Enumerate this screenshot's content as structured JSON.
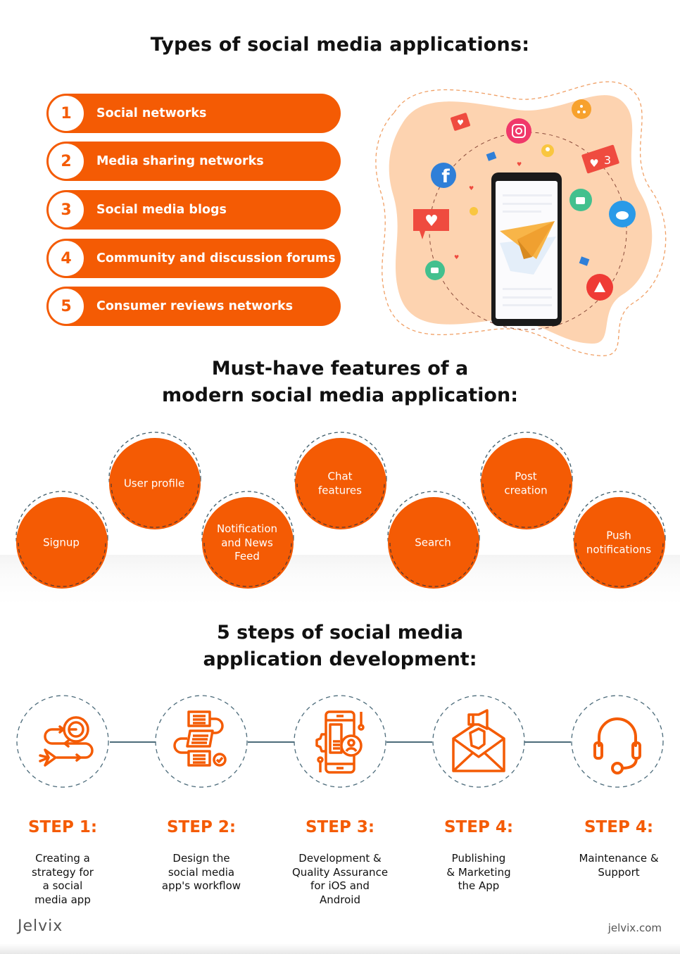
{
  "section_types": {
    "title": "Types of social media applications:",
    "items": [
      {
        "number": "1",
        "label": "Social networks"
      },
      {
        "number": "2",
        "label": "Media sharing networks"
      },
      {
        "number": "3",
        "label": "Social media blogs"
      },
      {
        "number": "4",
        "label": "Community and discussion forums"
      },
      {
        "number": "5",
        "label": "Consumer reviews networks"
      }
    ],
    "illustration": {
      "badge_count": "3",
      "icons": [
        "heart-comment-icon",
        "instagram-icon",
        "share-icon",
        "facebook-icon",
        "user-icon",
        "heart-count-icon",
        "thumbs-up-icon",
        "twitter-icon",
        "youtube-play-icon",
        "paper-plane-icon",
        "smartphone-icon"
      ]
    }
  },
  "section_features": {
    "title_line1": "Must-have features of a",
    "title_line2": "modern social media application:",
    "items": [
      {
        "line1": "Signup",
        "line2": "",
        "line3": ""
      },
      {
        "line1": "User profile",
        "line2": "",
        "line3": ""
      },
      {
        "line1": "Notification",
        "line2": "and News",
        "line3": "Feed"
      },
      {
        "line1": "Chat",
        "line2": "features",
        "line3": ""
      },
      {
        "line1": "Search",
        "line2": "",
        "line3": ""
      },
      {
        "line1": "Post",
        "line2": "creation",
        "line3": ""
      },
      {
        "line1": "Push",
        "line2": "notifications",
        "line3": ""
      }
    ]
  },
  "section_steps": {
    "title_line1": "5 steps of social media",
    "title_line2": "application development:",
    "steps": [
      {
        "heading": "STEP 1:",
        "desc": [
          "Creating a",
          "strategy for",
          "a social",
          "media app"
        ],
        "icon": "strategy-target-icon"
      },
      {
        "heading": "STEP 2:",
        "desc": [
          "Design the",
          "social media",
          "app's workflow"
        ],
        "icon": "workflow-icon"
      },
      {
        "heading": "STEP 3:",
        "desc": [
          "Development &",
          "Quality Assurance",
          "for iOS and",
          "Android"
        ],
        "icon": "mobile-development-icon"
      },
      {
        "heading": "STEP 4:",
        "desc": [
          "Publishing",
          "& Marketing",
          "the App"
        ],
        "icon": "marketing-megaphone-icon"
      },
      {
        "heading": "STEP 4:",
        "desc": [
          "Maintenance &",
          "Support"
        ],
        "icon": "headset-support-icon"
      }
    ]
  },
  "footer": {
    "logo": "Jelvix",
    "url": "jelvix.com"
  },
  "colors": {
    "accent": "#f45b04",
    "connector": "#4c6b7a",
    "blob": "#fdd3b0",
    "text": "#111111"
  }
}
